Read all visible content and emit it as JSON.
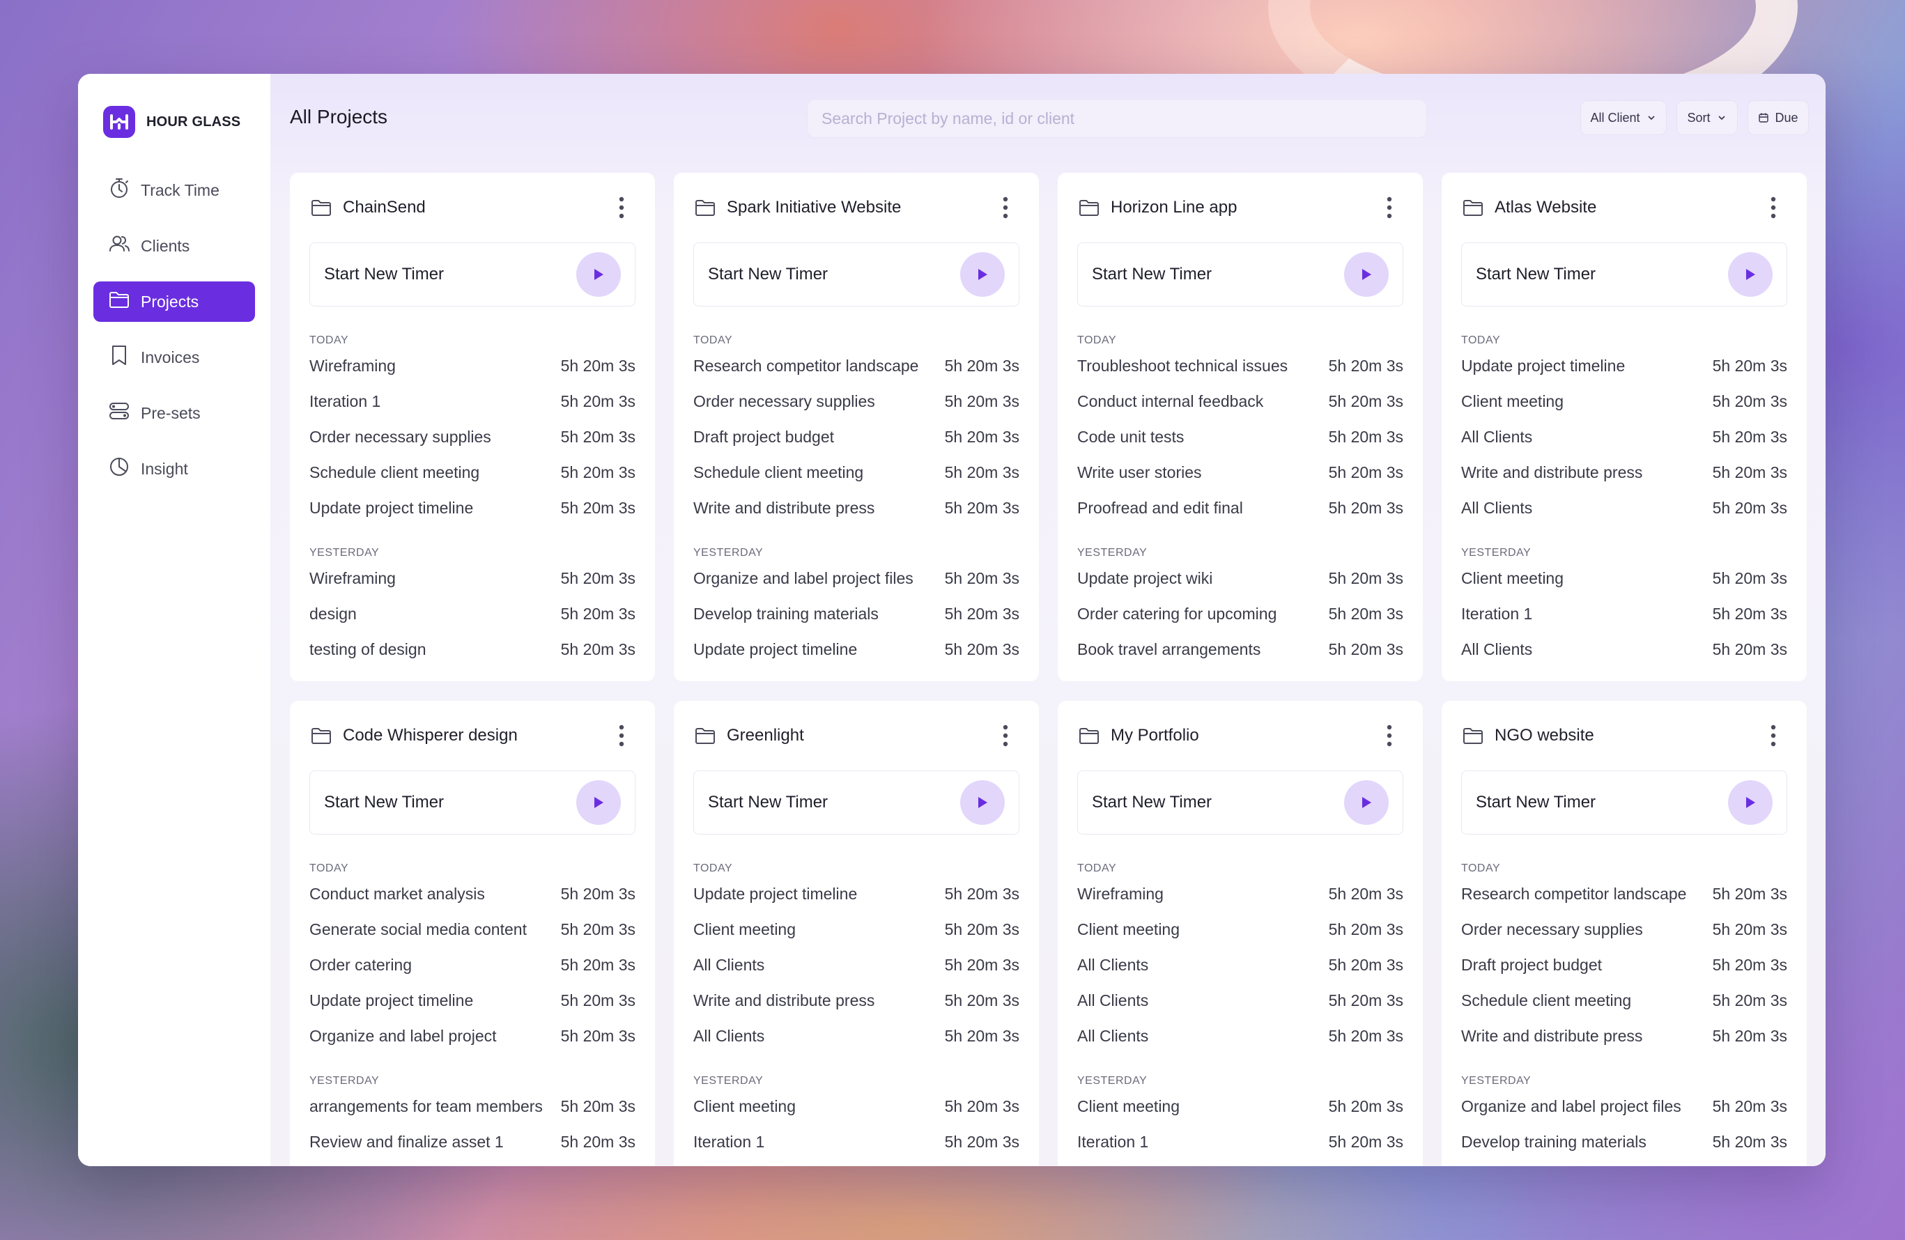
{
  "app": {
    "name": "HOUR GLASS"
  },
  "sidebar": {
    "items": [
      {
        "label": "Track Time",
        "icon": "stopwatch-icon"
      },
      {
        "label": "Clients",
        "icon": "users-icon"
      },
      {
        "label": "Projects",
        "icon": "folder-icon",
        "active": true
      },
      {
        "label": "Invoices",
        "icon": "invoice-icon"
      },
      {
        "label": "Pre-sets",
        "icon": "presets-icon"
      },
      {
        "label": "Insight",
        "icon": "pie-chart-icon"
      }
    ]
  },
  "header": {
    "title": "All Projects",
    "search_placeholder": "Search Project by name, id or client",
    "client_filter": "All Client",
    "sort_label": "Sort",
    "due_label": "Due"
  },
  "labels": {
    "start_timer": "Start New Timer",
    "today": "TODAY",
    "yesterday": "YESTERDAY"
  },
  "colors": {
    "accent": "#6A2EE0",
    "play_bg": "#E3D6FB"
  },
  "projects": [
    {
      "name": "ChainSend",
      "today": [
        [
          "Wireframing",
          "5h 20m 3s"
        ],
        [
          "Iteration 1",
          "5h 20m 3s"
        ],
        [
          "Order necessary supplies",
          "5h 20m 3s"
        ],
        [
          "Schedule client meeting",
          "5h 20m 3s"
        ],
        [
          "Update project timeline",
          "5h 20m 3s"
        ]
      ],
      "yesterday": [
        [
          "Wireframing",
          "5h 20m 3s"
        ],
        [
          "design",
          "5h 20m 3s"
        ],
        [
          "testing of design",
          "5h 20m 3s"
        ]
      ]
    },
    {
      "name": "Spark Initiative Website",
      "today": [
        [
          "Research competitor landscape",
          "5h 20m 3s"
        ],
        [
          "Order necessary supplies",
          "5h 20m 3s"
        ],
        [
          "Draft project budget",
          "5h 20m 3s"
        ],
        [
          "Schedule client meeting",
          "5h 20m 3s"
        ],
        [
          "Write and distribute press",
          "5h 20m 3s"
        ]
      ],
      "yesterday": [
        [
          "Organize and label project files",
          "5h 20m 3s"
        ],
        [
          "Develop training materials",
          "5h 20m 3s"
        ],
        [
          "Update project timeline",
          "5h 20m 3s"
        ]
      ]
    },
    {
      "name": "Horizon Line app",
      "today": [
        [
          "Troubleshoot technical issues",
          "5h 20m 3s"
        ],
        [
          "Conduct internal feedback",
          "5h 20m 3s"
        ],
        [
          "Code unit tests",
          "5h 20m 3s"
        ],
        [
          "Write user stories",
          "5h 20m 3s"
        ],
        [
          "Proofread and edit final",
          "5h 20m 3s"
        ]
      ],
      "yesterday": [
        [
          "Update project wiki",
          "5h 20m 3s"
        ],
        [
          "Order catering for upcoming",
          "5h 20m 3s"
        ],
        [
          "Book travel arrangements",
          "5h 20m 3s"
        ]
      ]
    },
    {
      "name": "Atlas Website",
      "today": [
        [
          "Update project timeline",
          "5h 20m 3s"
        ],
        [
          "Client meeting",
          "5h 20m 3s"
        ],
        [
          "All Clients",
          "5h 20m 3s"
        ],
        [
          "Write and distribute press",
          "5h 20m 3s"
        ],
        [
          "All Clients",
          "5h 20m 3s"
        ]
      ],
      "yesterday": [
        [
          "Client meeting",
          "5h 20m 3s"
        ],
        [
          "Iteration 1",
          "5h 20m 3s"
        ],
        [
          "All Clients",
          "5h 20m 3s"
        ]
      ]
    },
    {
      "name": "Code Whisperer design",
      "today": [
        [
          "Conduct market analysis",
          "5h 20m 3s"
        ],
        [
          "Generate social media content",
          "5h 20m 3s"
        ],
        [
          "Order catering",
          "5h 20m 3s"
        ],
        [
          "Update project timeline",
          "5h 20m 3s"
        ],
        [
          "Organize and label project",
          "5h 20m 3s"
        ]
      ],
      "yesterday": [
        [
          "arrangements for team members",
          "5h 20m 3s"
        ],
        [
          "Review and finalize asset 1",
          "5h 20m 3s"
        ]
      ]
    },
    {
      "name": "Greenlight",
      "today": [
        [
          "Update project timeline",
          "5h 20m 3s"
        ],
        [
          "Client meeting",
          "5h 20m 3s"
        ],
        [
          "All Clients",
          "5h 20m 3s"
        ],
        [
          "Write and distribute press",
          "5h 20m 3s"
        ],
        [
          "All Clients",
          "5h 20m 3s"
        ]
      ],
      "yesterday": [
        [
          "Client meeting",
          "5h 20m 3s"
        ],
        [
          "Iteration 1",
          "5h 20m 3s"
        ]
      ]
    },
    {
      "name": "My Portfolio",
      "today": [
        [
          "Wireframing",
          "5h 20m 3s"
        ],
        [
          "Client meeting",
          "5h 20m 3s"
        ],
        [
          "All Clients",
          "5h 20m 3s"
        ],
        [
          "All Clients",
          "5h 20m 3s"
        ],
        [
          "All Clients",
          "5h 20m 3s"
        ]
      ],
      "yesterday": [
        [
          "Client meeting",
          "5h 20m 3s"
        ],
        [
          "Iteration 1",
          "5h 20m 3s"
        ]
      ]
    },
    {
      "name": "NGO website",
      "today": [
        [
          "Research competitor landscape",
          "5h 20m 3s"
        ],
        [
          "Order necessary supplies",
          "5h 20m 3s"
        ],
        [
          "Draft project budget",
          "5h 20m 3s"
        ],
        [
          "Schedule client meeting",
          "5h 20m 3s"
        ],
        [
          "Write and distribute press",
          "5h 20m 3s"
        ]
      ],
      "yesterday": [
        [
          "Organize and label project files",
          "5h 20m 3s"
        ],
        [
          "Develop training materials",
          "5h 20m 3s"
        ]
      ]
    }
  ]
}
